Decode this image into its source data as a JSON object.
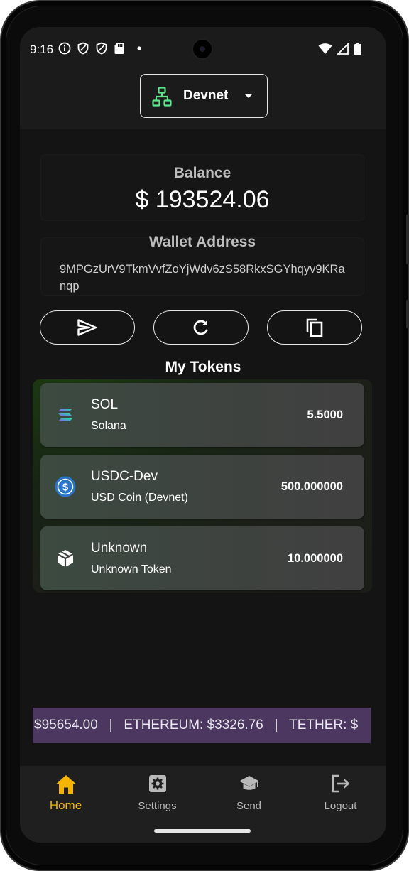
{
  "status_bar": {
    "time": "9:16",
    "left_icons": [
      "info-icon",
      "shield-icon",
      "shield-icon",
      "sd-card-icon",
      "dot-icon"
    ],
    "right_icons": [
      "wifi-icon",
      "signal-icon",
      "battery-icon"
    ]
  },
  "header": {
    "network_label": "Devnet",
    "network_icon": "network-tree-icon",
    "accent_color": "#5ee68a"
  },
  "balance": {
    "title": "Balance",
    "value": "$ 193524.06"
  },
  "wallet": {
    "title": "Wallet Address",
    "address": "9MPGzUrV9TkmVvfZoYjWdv6zS58RkxSGYhqyv9KRanqp"
  },
  "actions": [
    {
      "icon": "send-icon"
    },
    {
      "icon": "refresh-icon"
    },
    {
      "icon": "copy-icon"
    }
  ],
  "tokens": {
    "title": "My Tokens",
    "items": [
      {
        "symbol": "SOL",
        "name": "Solana",
        "amount": "5.5000",
        "icon": "solana-icon"
      },
      {
        "symbol": "USDC-Dev",
        "name": "USD Coin (Devnet)",
        "amount": "500.000000",
        "icon": "usdc-icon"
      },
      {
        "symbol": "Unknown",
        "name": "Unknown Token",
        "amount": "10.000000",
        "icon": "cube-icon"
      }
    ]
  },
  "ticker": {
    "text": "$95654.00   |   ETHEREUM: $3326.76   |   TETHER: $",
    "background": "#4b3760"
  },
  "nav": {
    "active_color": "#f5b400",
    "items": [
      {
        "label": "Home",
        "icon": "home-icon",
        "active": true
      },
      {
        "label": "Settings",
        "icon": "settings-icon",
        "active": false
      },
      {
        "label": "Send",
        "icon": "school-icon",
        "active": false
      },
      {
        "label": "Logout",
        "icon": "logout-icon",
        "active": false
      }
    ]
  }
}
